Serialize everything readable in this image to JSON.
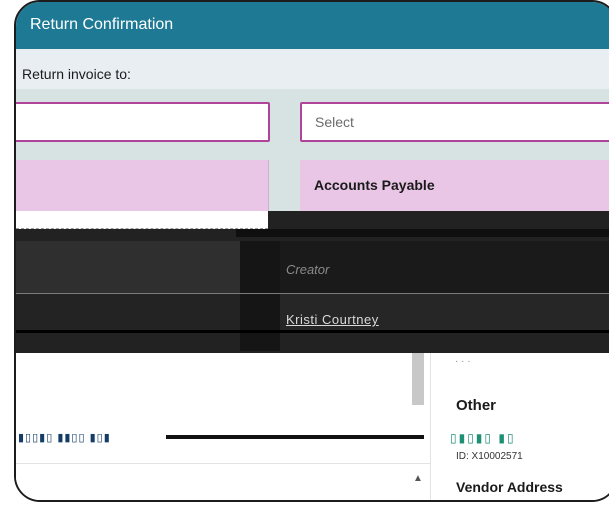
{
  "window": {
    "title": "Return Confirmation"
  },
  "return_row": {
    "label": "Return invoice to:"
  },
  "form": {
    "select_placeholder": "Select",
    "accounts_payable_label": "Accounts Payable"
  },
  "person": {
    "role": "Creator",
    "name": "Kristi Courtney"
  },
  "details": {
    "section_other": "Other",
    "vendor_id": "ID: X10002571",
    "vendor_address_heading": "Vendor Address"
  },
  "icons": {
    "scroll_up": "scroll-up-arrow-icon"
  }
}
